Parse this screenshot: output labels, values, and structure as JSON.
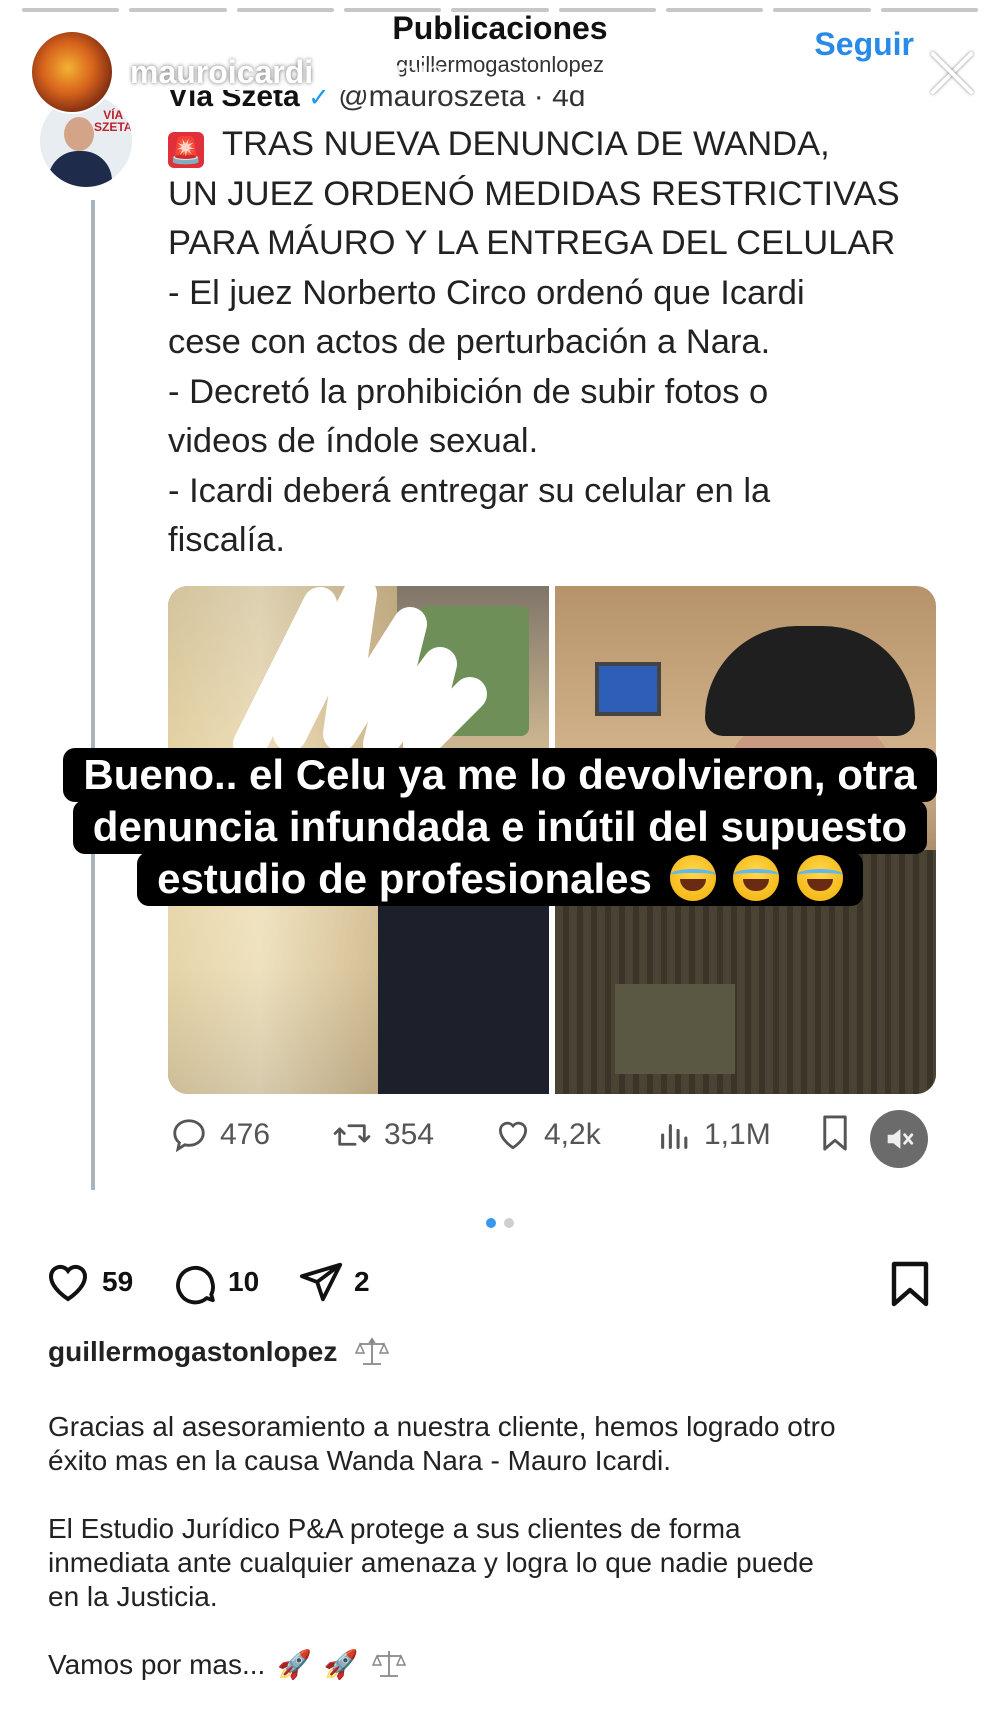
{
  "story": {
    "username": "mauroicardi",
    "time": "56 min",
    "progress_segments": 9
  },
  "header": {
    "title": "Publicaciones",
    "subtitle": "guillermogastonlopez",
    "follow_label": "Seguir",
    "more_label": "•••"
  },
  "tweet": {
    "author_name": "Vía Szeta",
    "verified": "✓",
    "handle_time": "@mauroszeta · 4d",
    "avatar_logo": "VÍA SZETA",
    "siren_icon": "🚨",
    "lines": [
      "TRAS NUEVA DENUNCIA DE WANDA,",
      "UN JUEZ ORDENÓ MEDIDAS RESTRICTIVAS",
      "PARA MÁURO Y LA ENTREGA DEL CELULAR",
      "- El juez Norberto Circo ordenó que Icardi",
      "cese con actos de perturbación a Nara.",
      "- Decretó la prohibición de subir fotos o",
      "videos de índole sexual.",
      "- Icardi deberá entregar su celular en la",
      "fiscalía."
    ],
    "metrics": {
      "replies": "476",
      "retweets": "354",
      "likes": "4,2k",
      "views": "1,1M"
    }
  },
  "overlay_caption": {
    "line1": "Bueno.. el Celu ya me lo devolvieron, otra",
    "line2": "denuncia infundada e inútil del supuesto",
    "line3": "estudio de profesionales"
  },
  "post": {
    "likes": "59",
    "comments": "10",
    "shares": "2",
    "author": "guillermogastonlopez",
    "caption": {
      "p1_line1": "Gracias al asesoramiento a nuestra cliente, hemos logrado otro",
      "p1_line2": "éxito mas en la causa Wanda Nara - Mauro Icardi.",
      "p2_line1": "El Estudio Jurídico P&A protege a sus clientes de forma",
      "p2_line2": "inmediata ante cualquier amenaza y logra lo que nadie puede",
      "p2_line3": "en la Justicia.",
      "p3": "Vamos por mas..."
    },
    "rocket_emoji": "🚀"
  },
  "colors": {
    "accent_blue": "#2a8ae8",
    "caption_bg": "#000000",
    "siren_red": "#e0303a"
  }
}
